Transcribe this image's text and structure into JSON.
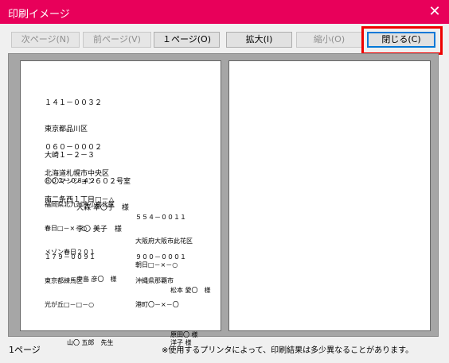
{
  "window": {
    "title": "印刷イメージ",
    "close_glyph": "✕"
  },
  "toolbar": {
    "next": "次ページ(N)",
    "prev": "前ページ(V)",
    "one_page": "１ページ(O)",
    "zoom_in": "拡大(I)",
    "zoom_out": "縮小(O)",
    "close": "閉じる(C)"
  },
  "labels": [
    {
      "zip": "１４１－００３２",
      "lines": [
        "東京都品川区",
        "大崎１－２－３",
        "〇〇マンション６０２号室"
      ],
      "name": "大森 幸〇子　様"
    },
    {
      "zip": "",
      "lines": [
        "",
        "",
        ""
      ],
      "name": ""
    },
    {
      "zip": "０６０－０００２",
      "lines": [
        "北海道札幌市中央区",
        "南二条西１丁目□－△"
      ],
      "name": "李〇 美子　様"
    },
    {
      "zip": "",
      "lines": [
        "",
        "",
        ""
      ],
      "name": ""
    },
    {
      "zip": "８０２－０８４２",
      "lines": [
        "福岡県北九州市小倉北区",
        "春日□－×－○",
        "メゾン春日２０１"
      ],
      "name": "中島 彦〇　様"
    },
    {
      "zip": "",
      "lines": [
        "",
        ""
      ],
      "name": ""
    },
    {
      "zip": "",
      "lines": [
        "",
        "",
        ""
      ],
      "name": ""
    },
    {
      "zip": "５５４－００１１",
      "lines": [
        "大阪府大阪市此花区",
        "朝日□－×－○"
      ],
      "name": "松本 愛〇　様"
    },
    {
      "zip": "１７９－００９１",
      "lines": [
        "東京都練馬区",
        "光が丘□－□－○",
        "",
        "",
        ""
      ],
      "name": "山〇 五郎　先生"
    },
    {
      "zip": "９００－０００１",
      "lines": [
        "沖縄県那覇市",
        "港町〇－×－〇"
      ],
      "name": "原田〇 様\n洋子 様"
    }
  ],
  "status": {
    "page": "1ページ",
    "note": "※使用するプリンタによって、印刷結果は多少異なることがあります。"
  }
}
